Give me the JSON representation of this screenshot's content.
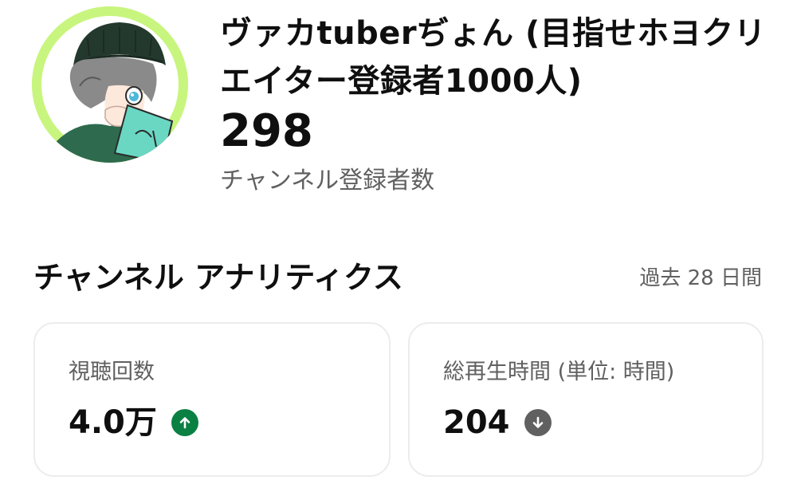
{
  "channel": {
    "avatar_icon": "channel-avatar",
    "name": "ヴァカtuberぢょん (目指せホヨクリエイター登録者1000人)",
    "subscriber_count": "298",
    "subscriber_label": "チャンネル登録者数"
  },
  "analytics": {
    "title": "チャンネル アナリティクス",
    "period": "過去 28 日間",
    "cards": [
      {
        "label": "視聴回数",
        "value": "4.0万",
        "trend": "up",
        "trend_icon": "arrow-up-circle-icon",
        "trend_color": "#0b8043"
      },
      {
        "label": "総再生時間 (単位: 時間)",
        "value": "204",
        "trend": "down",
        "trend_icon": "arrow-down-circle-icon",
        "trend_color": "#606060"
      }
    ]
  }
}
